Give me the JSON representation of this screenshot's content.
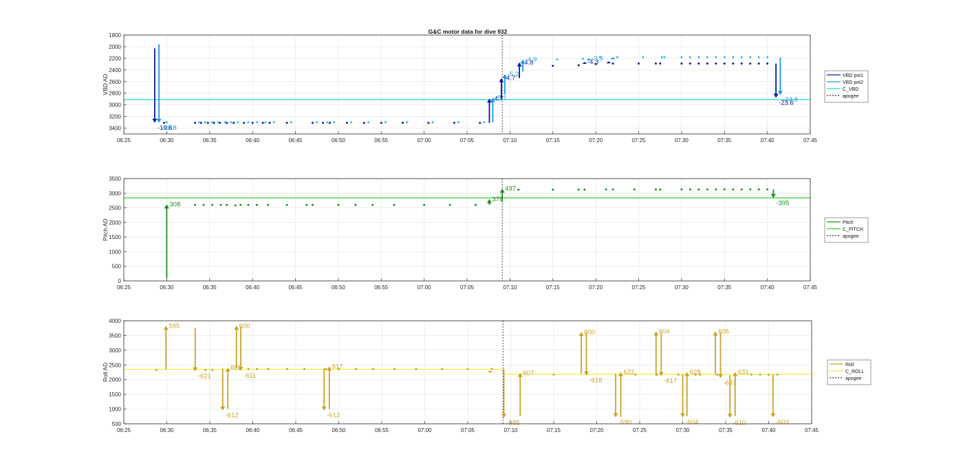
{
  "figure": {
    "title": "G&C motor data for dive 932"
  },
  "chart_data": [
    {
      "type": "scatter",
      "name": "vbd",
      "title": "G&C motor data for dive 932",
      "ylabel": "VBD AD",
      "xlim": [
        385,
        465
      ],
      "ylim": [
        1800,
        3500
      ],
      "y_reversed": true,
      "xticks": [
        385,
        390,
        395,
        400,
        405,
        410,
        415,
        420,
        425,
        430,
        435,
        440,
        445,
        450,
        455,
        460,
        465
      ],
      "xtick_labels": [
        "06:25",
        "06:30",
        "06:35",
        "06:40",
        "06:45",
        "06:50",
        "06:55",
        "07:00",
        "07:05",
        "07:10",
        "07:15",
        "07:20",
        "07:25",
        "07:30",
        "07:35",
        "07:40",
        "07:45"
      ],
      "yticks": [
        1800,
        2000,
        2200,
        2400,
        2600,
        2800,
        3000,
        3200,
        3400
      ],
      "grid": true,
      "legend": {
        "position": "right",
        "entries": [
          {
            "label": "VBD pot1",
            "color": "#0b1a99",
            "style": "solid"
          },
          {
            "label": "VBD pot2",
            "color": "#1a9ae0",
            "style": "solid"
          },
          {
            "label": "C_VBD",
            "color": "#22d5d5",
            "style": "solid"
          },
          {
            "label": "apogee",
            "color": "#333333",
            "style": "dotted"
          }
        ]
      },
      "hlines": [
        {
          "series": "C_VBD",
          "y": 2910,
          "color": "#22d5d5"
        }
      ],
      "vlines": [
        {
          "series": "apogee",
          "x": 429.1,
          "color": "#333333",
          "style": "dotted"
        }
      ],
      "series": [
        {
          "name": "VBD pot1",
          "color": "#0b1a99",
          "marker": "dot",
          "x": [
            389.7,
            393.3,
            394.0,
            394.8,
            395.5,
            396.2,
            397.0,
            397.8,
            399.0,
            400.0,
            401.2,
            402.0,
            404.0,
            407.0,
            408.2,
            409.0,
            411.0,
            413.0,
            415.0,
            417.5,
            420.5,
            423.5,
            426.5,
            435.0,
            438.0,
            440.0,
            442.0,
            445.0,
            447.0,
            447.5,
            450.0,
            451.0,
            452.0,
            453.0,
            454.0,
            455.0,
            456.0,
            457.0,
            458.0,
            459.0,
            460.0
          ],
          "y": [
            3310,
            3310,
            3310,
            3310,
            3310,
            3310,
            3310,
            3310,
            3310,
            3310,
            3310,
            3310,
            3310,
            3310,
            3310,
            3310,
            3310,
            3310,
            3310,
            3310,
            3310,
            3310,
            3310,
            2330,
            2320,
            2300,
            2290,
            2290,
            2290,
            2290,
            2290,
            2290,
            2290,
            2290,
            2290,
            2290,
            2290,
            2290,
            2290,
            2290,
            2290
          ]
        },
        {
          "name": "VBD pot2",
          "color": "#33bbee",
          "marker": "dot",
          "x": [
            390.0,
            393.8,
            394.5,
            395.3,
            396.0,
            396.8,
            397.5,
            398.3,
            399.5,
            400.5,
            401.5,
            402.5,
            404.5,
            407.5,
            408.7,
            409.5,
            411.5,
            413.5,
            415.5,
            418.0,
            421.0,
            424.0,
            427.0,
            435.5,
            438.5,
            440.5,
            442.5,
            445.5,
            447.7,
            448.0,
            450.0,
            451.0,
            452.0,
            453.0,
            454.0,
            455.0,
            456.0,
            457.0,
            458.0,
            459.0,
            460.0
          ],
          "y": [
            3300,
            3300,
            3300,
            3300,
            3300,
            3300,
            3300,
            3300,
            3300,
            3300,
            3300,
            3300,
            3300,
            3300,
            3300,
            3300,
            3300,
            3300,
            3300,
            3300,
            3300,
            3300,
            3300,
            2220,
            2210,
            2180,
            2180,
            2180,
            2180,
            2180,
            2180,
            2180,
            2180,
            2180,
            2180,
            2180,
            2180,
            2180,
            2180,
            2180,
            2180
          ]
        }
      ],
      "moves": [
        {
          "series": "VBD pot1",
          "x": 388.6,
          "from": 2030,
          "to": 3310,
          "label": "-19.6"
        },
        {
          "series": "VBD pot2",
          "x": 389.1,
          "from": 1960,
          "to": 3310,
          "label": "-20.8"
        },
        {
          "series": "VBD pot1",
          "x": 427.6,
          "from": 3310,
          "to": 2890,
          "label": "-4.7"
        },
        {
          "series": "VBD pot2",
          "x": 428.0,
          "from": 3300,
          "to": 2880,
          "label": "-5.1"
        },
        {
          "series": "VBD pot1",
          "x": 429.0,
          "from": 2890,
          "to": 2540,
          "label": "-4.7"
        },
        {
          "series": "VBD pot2",
          "x": 429.4,
          "from": 2820,
          "to": 2470,
          "label": "-5.2"
        },
        {
          "series": "VBD pot1",
          "x": 431.1,
          "from": 2540,
          "to": 2270,
          "label": "-4.8"
        },
        {
          "series": "VBD pot2",
          "x": 431.5,
          "from": 2430,
          "to": 2220,
          "label": "-4.9"
        },
        {
          "series": "VBD pot1",
          "x": 438.7,
          "from": 2280,
          "to": 2260,
          "label": "-4.3"
        },
        {
          "series": "VBD pot2",
          "x": 439.2,
          "from": 2220,
          "to": 2200,
          "label": "-3.9"
        },
        {
          "series": "VBD pot1",
          "x": 441.5,
          "from": 2270,
          "to": 2250,
          "label": ""
        },
        {
          "series": "VBD pot2",
          "x": 442.0,
          "from": 2200,
          "to": 2180,
          "label": ""
        },
        {
          "series": "VBD pot1",
          "x": 461.0,
          "from": 2290,
          "to": 2880,
          "label": "-23.6"
        },
        {
          "series": "VBD pot2",
          "x": 461.5,
          "from": 2190,
          "to": 2830,
          "label": "-24.8"
        }
      ]
    },
    {
      "type": "scatter",
      "name": "pitch",
      "ylabel": "Pitch AD",
      "xlim": [
        385,
        465
      ],
      "ylim": [
        0,
        3500
      ],
      "xticks": [
        385,
        390,
        395,
        400,
        405,
        410,
        415,
        420,
        425,
        430,
        435,
        440,
        445,
        450,
        455,
        460,
        465
      ],
      "xtick_labels": [
        "06:25",
        "06:30",
        "06:35",
        "06:40",
        "06:45",
        "06:50",
        "06:55",
        "07:00",
        "07:05",
        "07:10",
        "07:15",
        "07:20",
        "07:25",
        "07:30",
        "07:35",
        "07:40",
        "07:45"
      ],
      "yticks": [
        0,
        500,
        1000,
        1500,
        2000,
        2500,
        3000,
        3500
      ],
      "grid": true,
      "legend": {
        "position": "right",
        "entries": [
          {
            "label": "Pitch",
            "color": "#1e8a1e",
            "style": "solid"
          },
          {
            "label": "C_PITCH",
            "color": "#33cc33",
            "style": "solid"
          },
          {
            "label": "apogee",
            "color": "#333333",
            "style": "dotted"
          }
        ]
      },
      "hlines": [
        {
          "series": "C_PITCH",
          "y": 2840,
          "color": "#33cc33"
        }
      ],
      "vlines": [
        {
          "series": "apogee",
          "x": 429.1,
          "color": "#333333",
          "style": "dotted"
        }
      ],
      "series": [
        {
          "name": "Pitch",
          "color": "#1e8a1e",
          "marker": "dot",
          "x": [
            393.3,
            394.3,
            395.3,
            396.3,
            397.0,
            398.0,
            398.6,
            399.5,
            400.5,
            401.8,
            404.0,
            406.3,
            407.0,
            410.0,
            412.0,
            414.0,
            416.5,
            420.0,
            423.0,
            426.0,
            431.0,
            435.0,
            438.0,
            438.7,
            441.2,
            442.0,
            444.5,
            447.0,
            447.5,
            450.0,
            451.0,
            452.0,
            453.0,
            454.0,
            455.0,
            456.0,
            457.0,
            458.0,
            459.0,
            460.0
          ],
          "y": [
            2600,
            2600,
            2600,
            2600,
            2600,
            2580,
            2600,
            2600,
            2600,
            2600,
            2600,
            2600,
            2600,
            2600,
            2600,
            2600,
            2600,
            2600,
            2600,
            2600,
            3120,
            3120,
            3120,
            3120,
            3130,
            3130,
            3130,
            3130,
            3130,
            3130,
            3130,
            3130,
            3130,
            3130,
            3130,
            3130,
            3130,
            3130,
            3130,
            3130
          ]
        }
      ],
      "moves": [
        {
          "series": "Pitch",
          "x": 390.0,
          "from": 100,
          "to": 2620,
          "label": "308"
        },
        {
          "series": "Pitch",
          "x": 427.6,
          "from": 2600,
          "to": 2800,
          "label": "378"
        },
        {
          "series": "Pitch",
          "x": 429.1,
          "from": 2700,
          "to": 3160,
          "label": "437"
        },
        {
          "series": "Pitch",
          "x": 460.7,
          "from": 3130,
          "to": 2830,
          "label": "-395"
        }
      ]
    },
    {
      "type": "scatter",
      "name": "roll",
      "ylabel": "Roll AD",
      "xlim": [
        385,
        465
      ],
      "ylim": [
        500,
        4000
      ],
      "xticks": [
        385,
        390,
        395,
        400,
        405,
        410,
        415,
        420,
        425,
        430,
        435,
        440,
        445,
        450,
        455,
        460,
        465
      ],
      "xtick_labels": [
        "06:25",
        "06:30",
        "06:35",
        "06:40",
        "06:45",
        "06:50",
        "06:55",
        "07:00",
        "07:05",
        "07:10",
        "07:15",
        "07:20",
        "07:25",
        "07:30",
        "07:35",
        "07:40",
        "07:45"
      ],
      "yticks": [
        500,
        1000,
        1500,
        2000,
        2500,
        3000,
        3500,
        4000
      ],
      "grid": true,
      "legend": {
        "position": "right",
        "entries": [
          {
            "label": "Roll",
            "color": "#c9a227",
            "style": "solid"
          },
          {
            "label": "C_ROLL",
            "color": "#eeee44",
            "style": "solid"
          },
          {
            "label": "apogee",
            "color": "#333333",
            "style": "dotted"
          }
        ]
      },
      "hlines": [
        {
          "series": "C_ROLL",
          "x1": 385,
          "x2": 429.1,
          "y": 2350,
          "color": "#eeee44"
        },
        {
          "series": "C_ROLL",
          "x1": 429.1,
          "x2": 465,
          "y": 2180,
          "color": "#eeee44"
        }
      ],
      "vlines": [
        {
          "series": "apogee",
          "x": 429.1,
          "color": "#333333",
          "style": "dotted"
        }
      ],
      "series": [
        {
          "name": "Roll",
          "color": "#c9a227",
          "marker": "dot",
          "x": [
            388.8,
            394.5,
            395.3,
            398.5,
            399.5,
            400.5,
            401.8,
            404.0,
            406.0,
            408.5,
            410.0,
            412.0,
            414.0,
            416.5,
            419.0,
            422.0,
            425.0,
            427.8,
            435.0,
            444.5,
            447.0,
            449.5,
            451.5,
            452.0,
            454.0,
            458.0,
            459.0,
            460.0,
            461.0
          ],
          "y": [
            2330,
            2330,
            2330,
            2360,
            2360,
            2360,
            2360,
            2360,
            2360,
            2360,
            2360,
            2360,
            2360,
            2360,
            2360,
            2360,
            2360,
            2360,
            2170,
            2170,
            2170,
            2170,
            2170,
            2170,
            2170,
            2170,
            2170,
            2170,
            2170
          ]
        }
      ],
      "moves": [
        {
          "series": "Roll",
          "x": 389.9,
          "from": 2350,
          "to": 3830,
          "label": "595"
        },
        {
          "series": "Roll",
          "x": 393.3,
          "from": 3760,
          "to": 2280,
          "label": "-621"
        },
        {
          "series": "Roll",
          "x": 396.5,
          "from": 2380,
          "to": 950,
          "label": "-612"
        },
        {
          "series": "Roll",
          "x": 397.1,
          "from": 1000,
          "to": 2410,
          "label": "609"
        },
        {
          "series": "Roll",
          "x": 398.1,
          "from": 2400,
          "to": 3830,
          "label": "600"
        },
        {
          "series": "Roll",
          "x": 398.6,
          "from": 3800,
          "to": 2300,
          "label": "-611"
        },
        {
          "series": "Roll",
          "x": 408.3,
          "from": 2380,
          "to": 950,
          "label": "-612"
        },
        {
          "series": "Roll",
          "x": 408.9,
          "from": 1000,
          "to": 2450,
          "label": "617"
        },
        {
          "series": "Roll",
          "x": 427.6,
          "from": 2260,
          "to": 2220,
          "label": ""
        },
        {
          "series": "Roll",
          "x": 429.2,
          "from": 2350,
          "to": 700,
          "label": "-585"
        },
        {
          "series": "Roll",
          "x": 431.1,
          "from": 760,
          "to": 2230,
          "label": "607"
        },
        {
          "series": "Roll",
          "x": 438.2,
          "from": 2200,
          "to": 3620,
          "label": "600"
        },
        {
          "series": "Roll",
          "x": 438.8,
          "from": 3600,
          "to": 2140,
          "label": "-618"
        },
        {
          "series": "Roll",
          "x": 442.2,
          "from": 2200,
          "to": 720,
          "label": "-590"
        },
        {
          "series": "Roll",
          "x": 442.8,
          "from": 730,
          "to": 2260,
          "label": "622"
        },
        {
          "series": "Roll",
          "x": 446.9,
          "from": 2140,
          "to": 3640,
          "label": "604"
        },
        {
          "series": "Roll",
          "x": 447.5,
          "from": 3600,
          "to": 2120,
          "label": "-617"
        },
        {
          "series": "Roll",
          "x": 450.0,
          "from": 2180,
          "to": 720,
          "label": "-604"
        },
        {
          "series": "Roll",
          "x": 450.5,
          "from": 760,
          "to": 2260,
          "label": "628"
        },
        {
          "series": "Roll",
          "x": 453.8,
          "from": 2180,
          "to": 3640,
          "label": "605"
        },
        {
          "series": "Roll",
          "x": 454.4,
          "from": 3600,
          "to": 2050,
          "label": "-627"
        },
        {
          "series": "Roll",
          "x": 455.5,
          "from": 2150,
          "to": 700,
          "label": "-610"
        },
        {
          "series": "Roll",
          "x": 456.1,
          "from": 760,
          "to": 2260,
          "label": "631"
        },
        {
          "series": "Roll",
          "x": 460.5,
          "from": 2180,
          "to": 720,
          "label": "-603"
        }
      ]
    }
  ]
}
